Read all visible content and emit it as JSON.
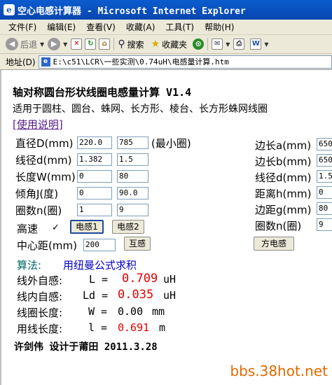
{
  "window": {
    "title": "空心电感计算器 - Microsoft Internet Explorer"
  },
  "menu": [
    "文件(F)",
    "编辑(E)",
    "查看(V)",
    "收藏(A)",
    "工具(T)",
    "帮助(H)"
  ],
  "toolbar": {
    "back": "后退",
    "search": "搜索",
    "favorites": "收藏夹"
  },
  "address": {
    "label": "地址(D)",
    "value": "E:\\c51\\LCR\\一些实测\\0.74uH\\电感量计算.htm"
  },
  "page": {
    "title": "轴对称圆台形状线圈电感量计算 V1.4",
    "subtitle": "适用于圆柱、圆台、蛛网、长方形、棱台、长方形蛛网线圈",
    "help_link": "[使用说明]",
    "left_fields": [
      {
        "label": "直径D(mm)",
        "v1": "220.0",
        "v2": "785",
        "note": "(最小圈)"
      },
      {
        "label": "线径d(mm)",
        "v1": "1.382",
        "v2": "1.5"
      },
      {
        "label": "长度W(mm)",
        "v1": "0",
        "v2": "80"
      },
      {
        "label": "倾角J(度)",
        "v1": "0",
        "v2": "90.0"
      },
      {
        "label": "圈数n(圈)",
        "v1": "1",
        "v2": "9"
      }
    ],
    "high_speed_label": "高速",
    "high_speed_checked": "✓",
    "btn_inductance1": "电感1",
    "btn_inductance2": "电感2",
    "center_distance_label": "中心距(mm)",
    "center_distance_value": "200",
    "btn_mutual": "互感",
    "right_fields": [
      {
        "label": "边长a(mm)",
        "value": "650"
      },
      {
        "label": "边长b(mm)",
        "value": "650"
      },
      {
        "label": "线径d(mm)",
        "value": "1.5"
      },
      {
        "label": "距离h(mm)",
        "value": "0"
      },
      {
        "label": "边距g(mm)",
        "value": "80"
      },
      {
        "label": "圈数n(圈)",
        "value": "9"
      }
    ],
    "btn_square": "方电感",
    "algo_label": "算法:",
    "algo_value": "用纽曼公式求积",
    "results": [
      {
        "label": "线外自感:",
        "sym": "L =",
        "value": "0.709",
        "unit": "uH"
      },
      {
        "label": "线内自感:",
        "sym": "Ld =",
        "value": "0.035",
        "unit": "uH"
      },
      {
        "label": "线圈长度:",
        "sym": "W =",
        "value": "0.00",
        "unit": "mm"
      },
      {
        "label": "用线长度:",
        "sym": "l =",
        "value": "0.691",
        "unit": "m"
      }
    ],
    "footer": "许剑伟 设计于莆田 2011.3.28",
    "watermark": "bbs.38hot.net"
  }
}
